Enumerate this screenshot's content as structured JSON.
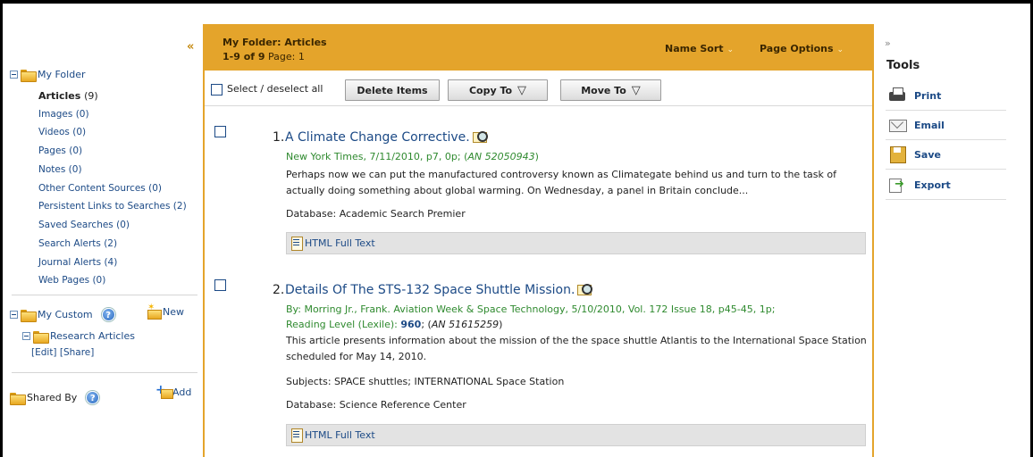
{
  "sidebar": {
    "collapse_glyph": "«",
    "my_folder": "My Folder",
    "items": [
      {
        "label": "Articles",
        "count": "(9)"
      },
      {
        "label": "Images (0)"
      },
      {
        "label": "Videos (0)"
      },
      {
        "label": "Pages (0)"
      },
      {
        "label": "Notes (0)"
      },
      {
        "label": "Other Content Sources (0)"
      },
      {
        "label": "Persistent Links to Searches (2)"
      },
      {
        "label": "Saved Searches (0)"
      },
      {
        "label": "Search Alerts (2)"
      },
      {
        "label": "Journal Alerts (4)"
      },
      {
        "label": "Web Pages (0)"
      }
    ],
    "my_custom": "My Custom",
    "new_label": "New",
    "research_articles": "Research Articles",
    "edit_label": "[Edit]",
    "share_label": "[Share]",
    "shared_by": "Shared By",
    "add_label": "Add",
    "help_glyph": "?"
  },
  "header": {
    "title": "My Folder: Articles",
    "range": "1-9 of 9",
    "page_label": "Page: 1",
    "name_sort": "Name Sort",
    "page_options": "Page Options",
    "chevron": "⌄"
  },
  "toolbar": {
    "select_label": "Select / deselect all",
    "delete_label": "Delete Items",
    "copy_label": "Copy To",
    "move_label": "Move To",
    "triangle": "▽"
  },
  "results": [
    {
      "num": "1.",
      "title": "A Climate Change Corrective.",
      "source": "New York Times, 7/11/2010, p7, 0p; (",
      "an": "AN 52050943",
      "source_end": ")",
      "abstract": "Perhaps now we can put the manufactured controversy known as Climategate behind us and turn to the task of actually doing something about global warming. On Wednesday, a panel in Britain conclude...",
      "database": "Database: Academic Search Premier",
      "fulltext": "HTML Full Text"
    },
    {
      "num": "2.",
      "title": "Details Of The STS-132 Space Shuttle Mission.",
      "source": "By: Morring Jr., Frank. Aviation Week & Space Technology, 5/10/2010, Vol. 172 Issue 18, p45-45, 1p;",
      "reading_label": "Reading Level (Lexile): ",
      "lexile": "960",
      "reading_sep": "; (",
      "an": "AN 51615259",
      "source_end": ")",
      "abstract": "This article presents information about the mission of the the space shuttle Atlantis to the International Space Station scheduled for May 14, 2010.",
      "subjects": "Subjects: SPACE shuttles; INTERNATIONAL Space Station",
      "database": "Database: Science Reference Center",
      "fulltext": "HTML Full Text"
    }
  ],
  "tools": {
    "expand_glyph": "»",
    "title": "Tools",
    "print": "Print",
    "email": "Email",
    "save": "Save",
    "export": "Export"
  }
}
